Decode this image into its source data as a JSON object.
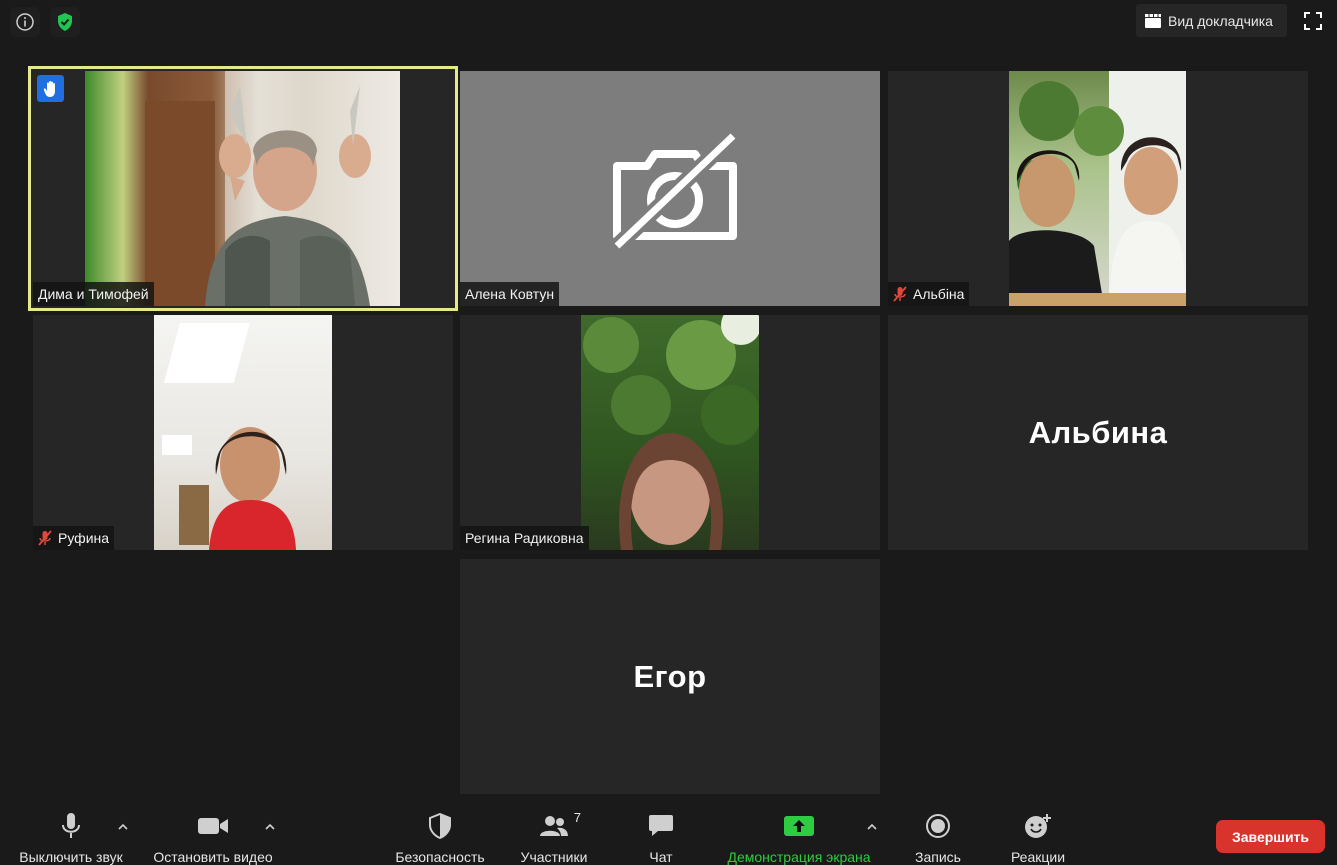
{
  "top": {
    "speaker_view_label": "Вид докладчика"
  },
  "participants": [
    {
      "name": "Дима и Тимофей",
      "muted": false,
      "raised_hand": true,
      "active_speaker": true,
      "video": true
    },
    {
      "name": "Алена Ковтун",
      "muted": false,
      "video": false,
      "camera_off_icon": true
    },
    {
      "name": "Альбіна",
      "muted": true,
      "video": true
    },
    {
      "name": "Руфина",
      "muted": true,
      "video": true
    },
    {
      "name": "Регина Радиковна",
      "muted": false,
      "video": true
    },
    {
      "name": "Альбина",
      "muted": false,
      "video": false
    },
    {
      "name": "Егор",
      "muted": false,
      "video": false
    }
  ],
  "toolbar": {
    "mute_label": "Выключить звук",
    "video_label": "Остановить видео",
    "security_label": "Безопасность",
    "participants_label": "Участники",
    "participants_count": "7",
    "chat_label": "Чат",
    "share_label": "Демонстрация экрана",
    "record_label": "Запись",
    "reactions_label": "Реакции",
    "end_label": "Завершить"
  },
  "colors": {
    "accent_share": "#2ecc40",
    "end_button": "#d9342b",
    "active_border": "#e4ea8a",
    "raise_hand": "#1f6fe0"
  }
}
